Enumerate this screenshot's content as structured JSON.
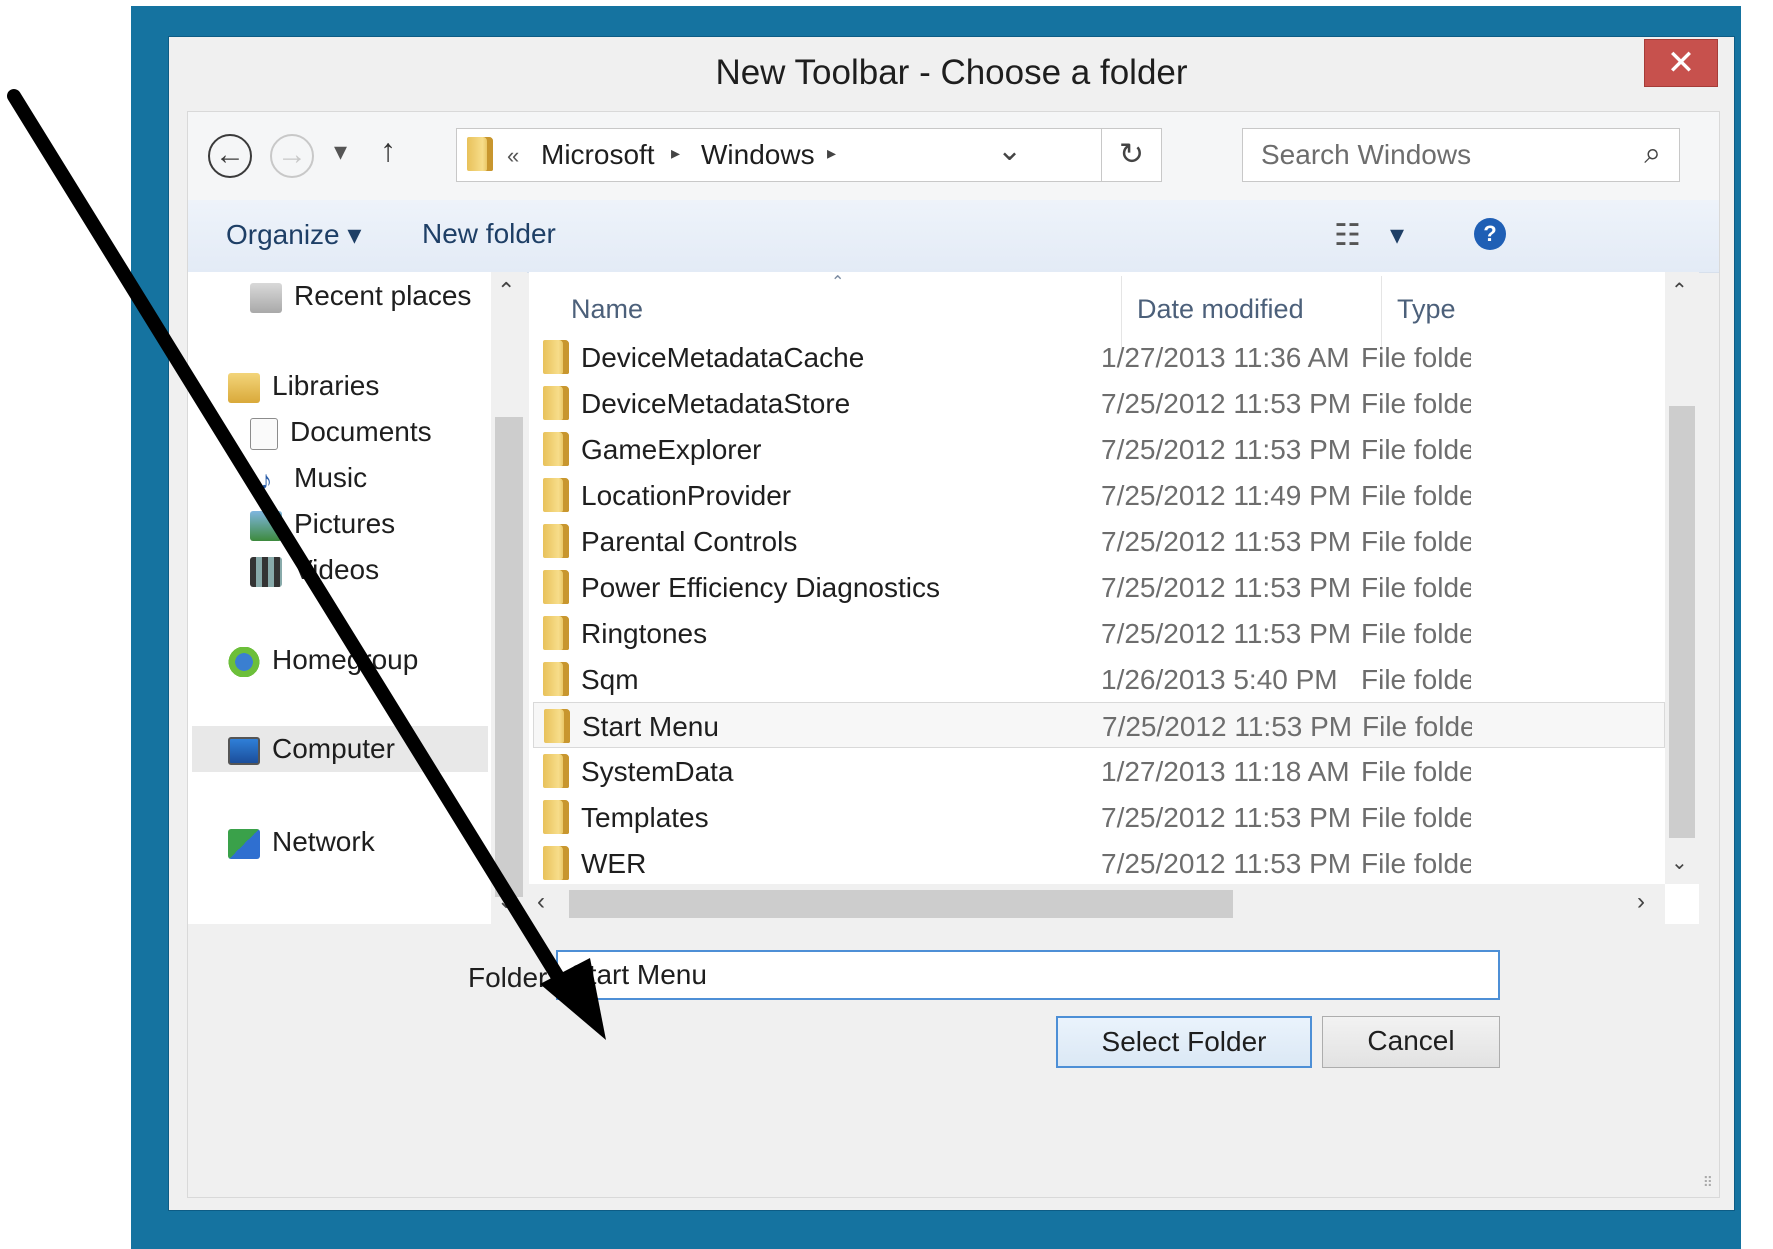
{
  "dialog": {
    "title": "New Toolbar - Choose a folder",
    "close_label": "✕"
  },
  "navigation": {
    "back_icon": "←",
    "forward_icon": "→",
    "recent_icon": "▾",
    "up_icon": "↑",
    "breadcrumb_overflow": "«",
    "breadcrumbs": [
      "Microsoft",
      "Windows"
    ],
    "breadcrumb_separator": "▸",
    "dropdown_icon": "⌄",
    "refresh_icon": "↻",
    "search_placeholder": "Search Windows",
    "search_icon": "⌕"
  },
  "command_bar": {
    "organize_label": "Organize ▾",
    "new_folder_label": "New folder",
    "views_icon": "☷",
    "views_menu_icon": "▾",
    "help_label": "?"
  },
  "nav_pane": {
    "items": [
      {
        "label": "Recent places",
        "icon": "recent-places-icon"
      },
      {
        "label": "Libraries",
        "icon": "libraries-icon"
      },
      {
        "label": "Documents",
        "icon": "documents-icon"
      },
      {
        "label": "Music",
        "icon": "music-icon"
      },
      {
        "label": "Pictures",
        "icon": "pictures-icon"
      },
      {
        "label": "Videos",
        "icon": "videos-icon"
      },
      {
        "label": "Homegroup",
        "icon": "homegroup-icon"
      },
      {
        "label": "Computer",
        "icon": "computer-icon"
      },
      {
        "label": "Network",
        "icon": "network-icon"
      }
    ],
    "scroll_up_icon": "⌃",
    "scroll_down_icon": "⌄"
  },
  "file_list": {
    "columns": [
      "Name",
      "Date modified",
      "Type"
    ],
    "sort_indicator": "⌃",
    "rows": [
      {
        "name": "DeviceMetadataCache",
        "date": "1/27/2013 11:36 AM",
        "type": "File folder"
      },
      {
        "name": "DeviceMetadataStore",
        "date": "7/25/2012 11:53 PM",
        "type": "File folder"
      },
      {
        "name": "GameExplorer",
        "date": "7/25/2012 11:53 PM",
        "type": "File folder"
      },
      {
        "name": "LocationProvider",
        "date": "7/25/2012 11:49 PM",
        "type": "File folder"
      },
      {
        "name": "Parental Controls",
        "date": "7/25/2012 11:53 PM",
        "type": "File folder"
      },
      {
        "name": "Power Efficiency Diagnostics",
        "date": "7/25/2012 11:53 PM",
        "type": "File folder"
      },
      {
        "name": "Ringtones",
        "date": "7/25/2012 11:53 PM",
        "type": "File folder"
      },
      {
        "name": "Sqm",
        "date": "1/26/2013 5:40 PM",
        "type": "File folder"
      },
      {
        "name": "Start Menu",
        "date": "7/25/2012 11:53 PM",
        "type": "File folder",
        "selected": true
      },
      {
        "name": "SystemData",
        "date": "1/27/2013 11:18 AM",
        "type": "File folder"
      },
      {
        "name": "Templates",
        "date": "7/25/2012 11:53 PM",
        "type": "File folder"
      },
      {
        "name": "WER",
        "date": "7/25/2012 11:53 PM",
        "type": "File folder"
      }
    ],
    "scroll_up_icon": "⌃",
    "scroll_down_icon": "⌄",
    "scroll_left_icon": "‹",
    "scroll_right_icon": "›"
  },
  "footer": {
    "folder_label": "Folder:",
    "folder_value": "Start Menu",
    "select_button": "Select Folder",
    "cancel_button": "Cancel",
    "resize_grip": "⠿"
  },
  "colors": {
    "frame": "#1573a0",
    "close": "#c7514d",
    "accent": "#4d8fd6",
    "annotation_arrow": "#000000"
  }
}
